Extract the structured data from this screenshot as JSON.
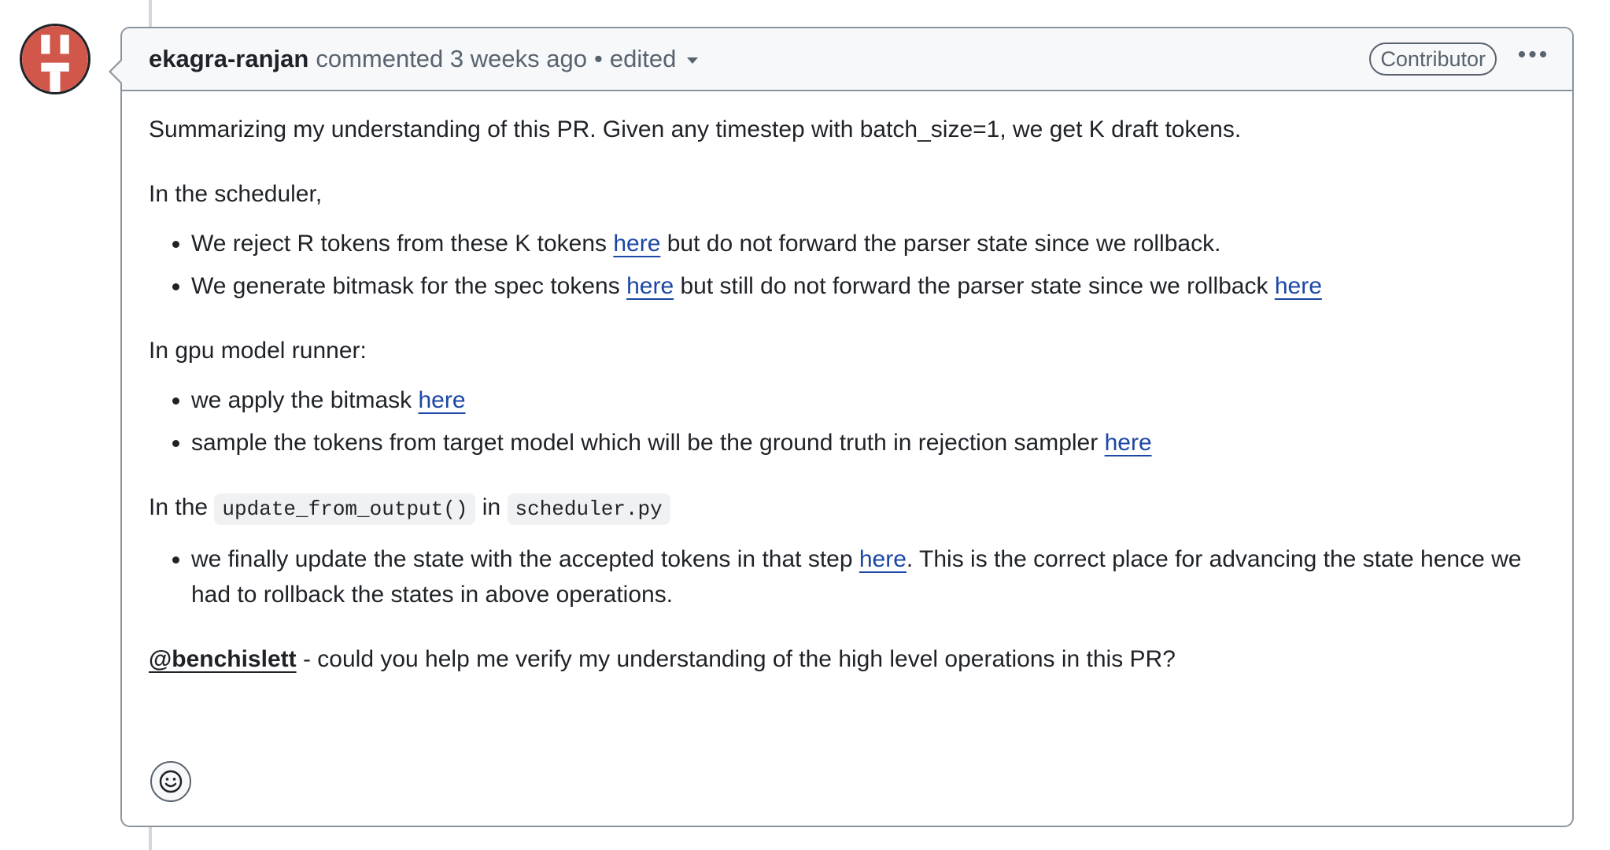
{
  "comment": {
    "author": "ekagra-ranjan",
    "action": "commented",
    "time": "3 weeks ago",
    "separator": "•",
    "edited_label": "edited",
    "badge": "Contributor",
    "menu_icon": "kebab-horizontal-icon"
  },
  "body": {
    "intro": "Summarizing my understanding of this PR. Given any timestep with batch_size=1, we get K draft tokens.",
    "scheduler_heading": "In the scheduler,",
    "scheduler_items": [
      {
        "before": "We reject R tokens from these K tokens ",
        "link": "here",
        "after": " but do not forward the parser state since we rollback."
      },
      {
        "before": "We generate bitmask for the spec tokens ",
        "link": "here",
        "middle": " but still do not forward the parser state since we rollback ",
        "link2": "here"
      }
    ],
    "gpu_heading": "In gpu model runner:",
    "gpu_items": [
      {
        "before": "we apply the bitmask ",
        "link": "here"
      },
      {
        "before": "sample the tokens from target model which will be the ground truth in rejection sampler ",
        "link": "here"
      }
    ],
    "update_heading": {
      "prefix": "In the ",
      "code1": "update_from_output()",
      "mid": " in ",
      "code2": "scheduler.py"
    },
    "update_items": [
      {
        "before": "we finally update the state with the accepted tokens in that step ",
        "link": "here",
        "after": ". This is the correct place for advancing the state hence we had to rollback the states in above operations."
      }
    ],
    "closing": {
      "mention": "@benchislett",
      "text": " - could you help me verify my understanding of the high level operations in this PR?"
    }
  },
  "reaction_icon": "smiley-icon",
  "colors": {
    "link": "#1b47a6",
    "avatar_red": "#d1574a",
    "border": "#8c959f",
    "header_bg": "#f6f8fa"
  }
}
